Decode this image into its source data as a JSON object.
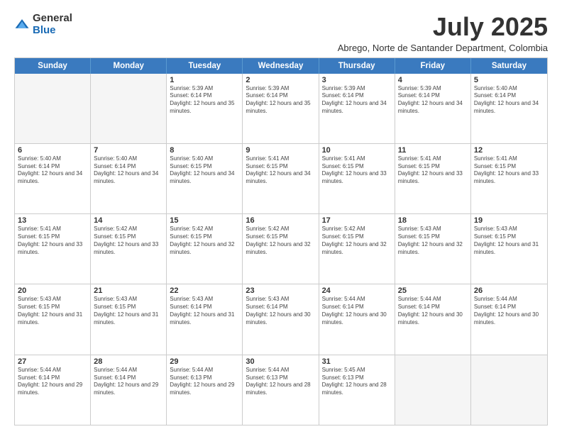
{
  "logo": {
    "general": "General",
    "blue": "Blue"
  },
  "title": "July 2025",
  "subtitle": "Abrego, Norte de Santander Department, Colombia",
  "header_days": [
    "Sunday",
    "Monday",
    "Tuesday",
    "Wednesday",
    "Thursday",
    "Friday",
    "Saturday"
  ],
  "weeks": [
    [
      {
        "day": "",
        "sunrise": "",
        "sunset": "",
        "daylight": ""
      },
      {
        "day": "",
        "sunrise": "",
        "sunset": "",
        "daylight": ""
      },
      {
        "day": "1",
        "sunrise": "Sunrise: 5:39 AM",
        "sunset": "Sunset: 6:14 PM",
        "daylight": "Daylight: 12 hours and 35 minutes."
      },
      {
        "day": "2",
        "sunrise": "Sunrise: 5:39 AM",
        "sunset": "Sunset: 6:14 PM",
        "daylight": "Daylight: 12 hours and 35 minutes."
      },
      {
        "day": "3",
        "sunrise": "Sunrise: 5:39 AM",
        "sunset": "Sunset: 6:14 PM",
        "daylight": "Daylight: 12 hours and 34 minutes."
      },
      {
        "day": "4",
        "sunrise": "Sunrise: 5:39 AM",
        "sunset": "Sunset: 6:14 PM",
        "daylight": "Daylight: 12 hours and 34 minutes."
      },
      {
        "day": "5",
        "sunrise": "Sunrise: 5:40 AM",
        "sunset": "Sunset: 6:14 PM",
        "daylight": "Daylight: 12 hours and 34 minutes."
      }
    ],
    [
      {
        "day": "6",
        "sunrise": "Sunrise: 5:40 AM",
        "sunset": "Sunset: 6:14 PM",
        "daylight": "Daylight: 12 hours and 34 minutes."
      },
      {
        "day": "7",
        "sunrise": "Sunrise: 5:40 AM",
        "sunset": "Sunset: 6:14 PM",
        "daylight": "Daylight: 12 hours and 34 minutes."
      },
      {
        "day": "8",
        "sunrise": "Sunrise: 5:40 AM",
        "sunset": "Sunset: 6:15 PM",
        "daylight": "Daylight: 12 hours and 34 minutes."
      },
      {
        "day": "9",
        "sunrise": "Sunrise: 5:41 AM",
        "sunset": "Sunset: 6:15 PM",
        "daylight": "Daylight: 12 hours and 34 minutes."
      },
      {
        "day": "10",
        "sunrise": "Sunrise: 5:41 AM",
        "sunset": "Sunset: 6:15 PM",
        "daylight": "Daylight: 12 hours and 33 minutes."
      },
      {
        "day": "11",
        "sunrise": "Sunrise: 5:41 AM",
        "sunset": "Sunset: 6:15 PM",
        "daylight": "Daylight: 12 hours and 33 minutes."
      },
      {
        "day": "12",
        "sunrise": "Sunrise: 5:41 AM",
        "sunset": "Sunset: 6:15 PM",
        "daylight": "Daylight: 12 hours and 33 minutes."
      }
    ],
    [
      {
        "day": "13",
        "sunrise": "Sunrise: 5:41 AM",
        "sunset": "Sunset: 6:15 PM",
        "daylight": "Daylight: 12 hours and 33 minutes."
      },
      {
        "day": "14",
        "sunrise": "Sunrise: 5:42 AM",
        "sunset": "Sunset: 6:15 PM",
        "daylight": "Daylight: 12 hours and 33 minutes."
      },
      {
        "day": "15",
        "sunrise": "Sunrise: 5:42 AM",
        "sunset": "Sunset: 6:15 PM",
        "daylight": "Daylight: 12 hours and 32 minutes."
      },
      {
        "day": "16",
        "sunrise": "Sunrise: 5:42 AM",
        "sunset": "Sunset: 6:15 PM",
        "daylight": "Daylight: 12 hours and 32 minutes."
      },
      {
        "day": "17",
        "sunrise": "Sunrise: 5:42 AM",
        "sunset": "Sunset: 6:15 PM",
        "daylight": "Daylight: 12 hours and 32 minutes."
      },
      {
        "day": "18",
        "sunrise": "Sunrise: 5:43 AM",
        "sunset": "Sunset: 6:15 PM",
        "daylight": "Daylight: 12 hours and 32 minutes."
      },
      {
        "day": "19",
        "sunrise": "Sunrise: 5:43 AM",
        "sunset": "Sunset: 6:15 PM",
        "daylight": "Daylight: 12 hours and 31 minutes."
      }
    ],
    [
      {
        "day": "20",
        "sunrise": "Sunrise: 5:43 AM",
        "sunset": "Sunset: 6:15 PM",
        "daylight": "Daylight: 12 hours and 31 minutes."
      },
      {
        "day": "21",
        "sunrise": "Sunrise: 5:43 AM",
        "sunset": "Sunset: 6:15 PM",
        "daylight": "Daylight: 12 hours and 31 minutes."
      },
      {
        "day": "22",
        "sunrise": "Sunrise: 5:43 AM",
        "sunset": "Sunset: 6:14 PM",
        "daylight": "Daylight: 12 hours and 31 minutes."
      },
      {
        "day": "23",
        "sunrise": "Sunrise: 5:43 AM",
        "sunset": "Sunset: 6:14 PM",
        "daylight": "Daylight: 12 hours and 30 minutes."
      },
      {
        "day": "24",
        "sunrise": "Sunrise: 5:44 AM",
        "sunset": "Sunset: 6:14 PM",
        "daylight": "Daylight: 12 hours and 30 minutes."
      },
      {
        "day": "25",
        "sunrise": "Sunrise: 5:44 AM",
        "sunset": "Sunset: 6:14 PM",
        "daylight": "Daylight: 12 hours and 30 minutes."
      },
      {
        "day": "26",
        "sunrise": "Sunrise: 5:44 AM",
        "sunset": "Sunset: 6:14 PM",
        "daylight": "Daylight: 12 hours and 30 minutes."
      }
    ],
    [
      {
        "day": "27",
        "sunrise": "Sunrise: 5:44 AM",
        "sunset": "Sunset: 6:14 PM",
        "daylight": "Daylight: 12 hours and 29 minutes."
      },
      {
        "day": "28",
        "sunrise": "Sunrise: 5:44 AM",
        "sunset": "Sunset: 6:14 PM",
        "daylight": "Daylight: 12 hours and 29 minutes."
      },
      {
        "day": "29",
        "sunrise": "Sunrise: 5:44 AM",
        "sunset": "Sunset: 6:13 PM",
        "daylight": "Daylight: 12 hours and 29 minutes."
      },
      {
        "day": "30",
        "sunrise": "Sunrise: 5:44 AM",
        "sunset": "Sunset: 6:13 PM",
        "daylight": "Daylight: 12 hours and 28 minutes."
      },
      {
        "day": "31",
        "sunrise": "Sunrise: 5:45 AM",
        "sunset": "Sunset: 6:13 PM",
        "daylight": "Daylight: 12 hours and 28 minutes."
      },
      {
        "day": "",
        "sunrise": "",
        "sunset": "",
        "daylight": ""
      },
      {
        "day": "",
        "sunrise": "",
        "sunset": "",
        "daylight": ""
      }
    ]
  ]
}
